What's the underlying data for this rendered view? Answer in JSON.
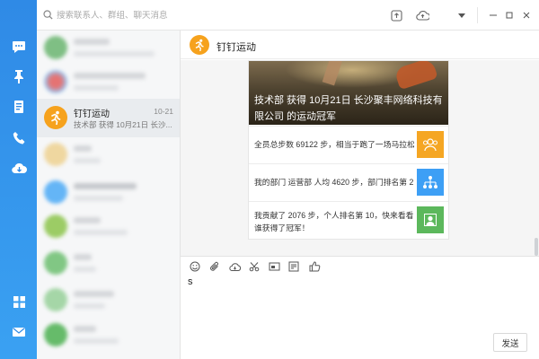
{
  "search": {
    "placeholder": "搜索联系人、群组、聊天消息"
  },
  "conversations": [
    {
      "blurred": true,
      "avatar_color": "#7fbf84"
    },
    {
      "blurred": true,
      "avatar_color": "#e57373"
    },
    {
      "blurred": false,
      "title": "钉钉运动",
      "time": "10-21",
      "preview": "技术部 获得 10月21日 长沙..."
    },
    {
      "blurred": true,
      "avatar_color": "#e6c27a"
    },
    {
      "blurred": true,
      "avatar_color": "#64b5f6"
    },
    {
      "blurred": true,
      "avatar_color": "#9ccc65"
    },
    {
      "blurred": true,
      "avatar_color": "#81c784"
    },
    {
      "blurred": true,
      "avatar_color": "#a5d6a7"
    },
    {
      "blurred": true,
      "avatar_color": "#66bb6a"
    }
  ],
  "chat": {
    "title": "钉钉运动",
    "card": {
      "banner_line1": "技术部 获得 10月21日 长沙聚丰网络科技有",
      "banner_line2": "限公司 的运动冠军",
      "items": [
        {
          "text": "全员总步数 69122 步，相当于跑了一场马拉松",
          "icon": "team-icon",
          "color": "#f5a623"
        },
        {
          "text": "我的部门 运营部 人均 4620 步，部门排名第 2",
          "icon": "org-chart-icon",
          "color": "#3d9ff5"
        },
        {
          "text": "我贡献了 2076 步，个人排名第 10，快来看看",
          "text2": "谁获得了冠军！",
          "icon": "person-icon",
          "color": "#5cb85c"
        }
      ]
    },
    "compose_value": "s",
    "send_label": "发送"
  },
  "colors": {
    "rail": "#2f8ae6",
    "accent": "#3d9ff5"
  }
}
